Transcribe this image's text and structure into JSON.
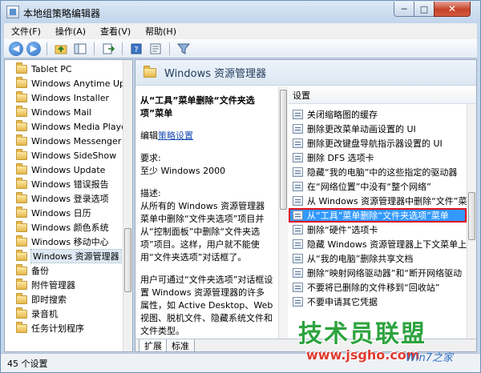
{
  "window": {
    "title": "本地组策略编辑器"
  },
  "titlebar": {
    "minimize": "─",
    "maximize": "□",
    "close": "✕"
  },
  "menu": [
    "文件(F)",
    "操作(A)",
    "查看(V)",
    "帮助(H)"
  ],
  "toolbar": {
    "icons": [
      "back-icon",
      "forward-icon",
      "up-folder-icon",
      "show-hide-tree-icon",
      "export-list-icon",
      "help-icon",
      "properties-icon",
      "filter-icon"
    ]
  },
  "tree": {
    "items": [
      "Tablet PC",
      "Windows Anytime Up",
      "Windows Installer",
      "Windows Mail",
      "Windows Media Playe",
      "Windows Messenger",
      "Windows SideShow",
      "Windows Update",
      "Windows 错误报告",
      "Windows 登录选项",
      "Windows 日历",
      "Windows 颜色系统",
      "Windows 移动中心",
      "Windows 资源管理器",
      "备份",
      "附件管理器",
      "即时搜索",
      "录音机",
      "任务计划程序"
    ],
    "selected": "Windows 资源管理器"
  },
  "right_pane": {
    "header": "Windows 资源管理器",
    "description": {
      "title": "从“工具”菜单删除“文件夹选项”菜单",
      "edit_prefix": "编辑",
      "edit_link": "策略设置",
      "req_label": "要求:",
      "req_value": "至少 Windows 2000",
      "desc_label": "描述:",
      "desc_text": "从所有的 Windows 资源管理器菜单中删除“文件夹选项”项目并从“控制面板”中删除“文件夹选项”项目。这样，用户就不能使用“文件夹选项”对话框了。",
      "extra_text": "用户可通过“文件夹选项”对话框设置 Windows 资源管理器的许多属性，如 Active Desktop、Web 视图、脱机文件、隐藏系统文件和文件类型。"
    },
    "settings_header": "设置",
    "settings": [
      "关闭缩略图的缓存",
      "删除更改菜单动画设置的 UI",
      "删除更改键盘导航指示器设置的 UI",
      "删除 DFS 选项卡",
      "隐藏“我的电脑”中的这些指定的驱动器",
      "在“网络位置”中没有“整个网络”",
      "从 Windows 资源管理器中删除“文件”菜单",
      "从“工具”菜单删除“文件夹选项”菜单",
      "删除“硬件”选项卡",
      "隐藏 Windows 资源管理器上下文菜单上",
      "从“我的电脑”删除共享文档",
      "删除“映射网络驱动器”和“断开网络驱动",
      "不要将已删除的文件移到“回收站”",
      "不要申请其它凭据"
    ],
    "selected_setting": "从“工具”菜单删除“文件夹选项”菜单",
    "tabs": [
      "扩展",
      "标准"
    ],
    "active_tab": "扩展"
  },
  "status": {
    "text": "45 个设置"
  },
  "watermark": {
    "main": "技术员联盟",
    "url": "www.jsgho.com",
    "suffix": "Win7之家"
  },
  "colors": {
    "selection": "#3399ff",
    "highlight_border": "#e0141e",
    "watermark_green": "#2ea33f"
  }
}
